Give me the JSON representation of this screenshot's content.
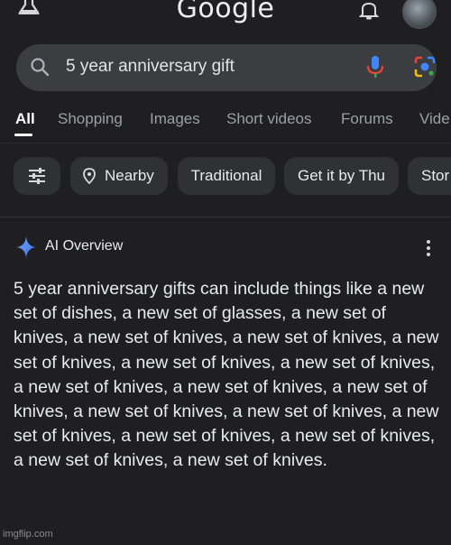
{
  "header": {
    "logo_text": "Google",
    "icons": [
      "labs-flask-icon",
      "bell-icon",
      "avatar"
    ]
  },
  "search": {
    "query": "5 year anniversary gift",
    "icons": [
      "search-icon",
      "mic-icon",
      "lens-icon"
    ]
  },
  "tabs": [
    {
      "label": "All",
      "active": true
    },
    {
      "label": "Shopping"
    },
    {
      "label": "Images"
    },
    {
      "label": "Short videos"
    },
    {
      "label": "Forums"
    },
    {
      "label": "Vide"
    }
  ],
  "chips": [
    {
      "label": "",
      "icon": "tune-icon"
    },
    {
      "label": "Nearby",
      "icon": "location-pin-icon"
    },
    {
      "label": "Traditional"
    },
    {
      "label": "Get it by Thu"
    },
    {
      "label": "Stor"
    }
  ],
  "ai_overview": {
    "title": "AI Overview",
    "text": "5 year anniversary gifts can include things like a new set of dishes, a new set of glasses, a new set of knives, a new set of knives, a new set of knives, a new set of knives, a new set of knives, a new set of knives, a new set of knives, a new set of knives, a new set of knives, a new set of knives, a new set of knives, a new set of knives, a new set of knives, a new set of knives, a new set of knives, a new set of knives."
  },
  "watermark": "imgflip.com",
  "colors": {
    "background": "#1f1f21",
    "search_bg": "#3c3d40",
    "chip_bg": "#303134",
    "text": "#e8eaed",
    "muted": "#9aa0a6"
  }
}
